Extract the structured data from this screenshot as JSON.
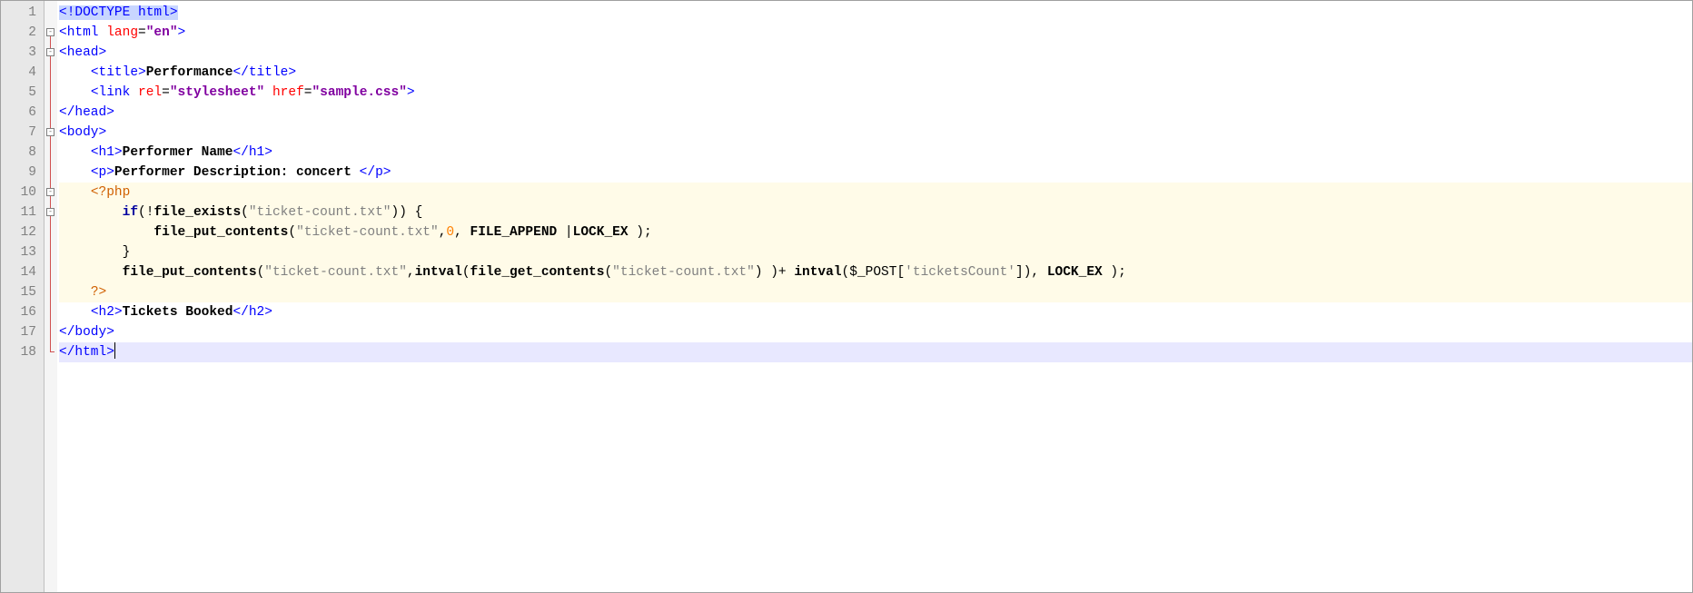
{
  "line_numbers": [
    "1",
    "2",
    "3",
    "4",
    "5",
    "6",
    "7",
    "8",
    "9",
    "10",
    "11",
    "12",
    "13",
    "14",
    "15",
    "16",
    "17",
    "18"
  ],
  "fold": {
    "boxes": {
      "2": "-",
      "3": "-",
      "7": "-",
      "10": "-",
      "11": "-"
    },
    "vline_start": 2,
    "vline_end": 18,
    "corner_row": 18
  },
  "code": {
    "r1": {
      "doctype_open": "<!",
      "doctype_word": "DOCTYPE",
      "space": " ",
      "doctype_html": "html",
      "gt": ">"
    },
    "r2": {
      "open": "<html",
      "sp": " ",
      "attr": "lang",
      "eq": "=",
      "val": "\"en\"",
      "close": ">"
    },
    "r3": {
      "open": "<head",
      "close": ">"
    },
    "r4": {
      "indent": "    ",
      "open": "<title>",
      "text": "Performance",
      "closeTag": "</title>"
    },
    "r5": {
      "indent": "    ",
      "open": "<link",
      "sp1": " ",
      "a1": "rel",
      "eq1": "=",
      "v1": "\"stylesheet\"",
      "sp2": " ",
      "a2": "href",
      "eq2": "=",
      "v2": "\"sample.css\"",
      "close": ">"
    },
    "r6": {
      "closeTag": "</head>"
    },
    "r7": {
      "open": "<body",
      "close": ">"
    },
    "r8": {
      "indent": "    ",
      "open": "<h1>",
      "text": "Performer Name",
      "closeTag": "</h1>"
    },
    "r9": {
      "indent": "    ",
      "open": "<p>",
      "text": "Performer Description: concert ",
      "closeTag": "</p>"
    },
    "r10": {
      "indent": "    ",
      "phpopen": "<?php"
    },
    "r11": {
      "indent": "        ",
      "kw": "if",
      "p1": "(!",
      "fn": "file_exists",
      "p2": "(",
      "s": "\"ticket-count.txt\"",
      "p3": ")) {"
    },
    "r12": {
      "indent": "            ",
      "fn": "file_put_contents",
      "p1": "(",
      "s1": "\"ticket-count.txt\"",
      "c1": ",",
      "num": "0",
      "c2": ", ",
      "kw1": "FILE_APPEND",
      "sp": " |",
      "kw2": "LOCK_EX",
      "end": " );"
    },
    "r13": {
      "indent": "        ",
      "brace": "}"
    },
    "r14": {
      "indent": "        ",
      "fn1": "file_put_contents",
      "p1": "(",
      "s1": "\"ticket-count.txt\"",
      "c1": ",",
      "fn2": "intval",
      "p2": "(",
      "fn3": "file_get_contents",
      "p3": "(",
      "s2": "\"ticket-count.txt\"",
      "p4": ") )+ ",
      "fn4": "intval",
      "p5": "(",
      "var": "$_POST",
      "br1": "[",
      "s3": "'ticketsCount'",
      "br2": "]), ",
      "kw": "LOCK_EX",
      "end": " );"
    },
    "r15": {
      "indent": "    ",
      "phpclose": "?>"
    },
    "r16": {
      "indent": "    ",
      "open": "<h2>",
      "text": "Tickets Booked",
      "closeTag": "</h2>"
    },
    "r17": {
      "closeTag": "</body>"
    },
    "r18": {
      "closeTag": "</html>"
    }
  }
}
